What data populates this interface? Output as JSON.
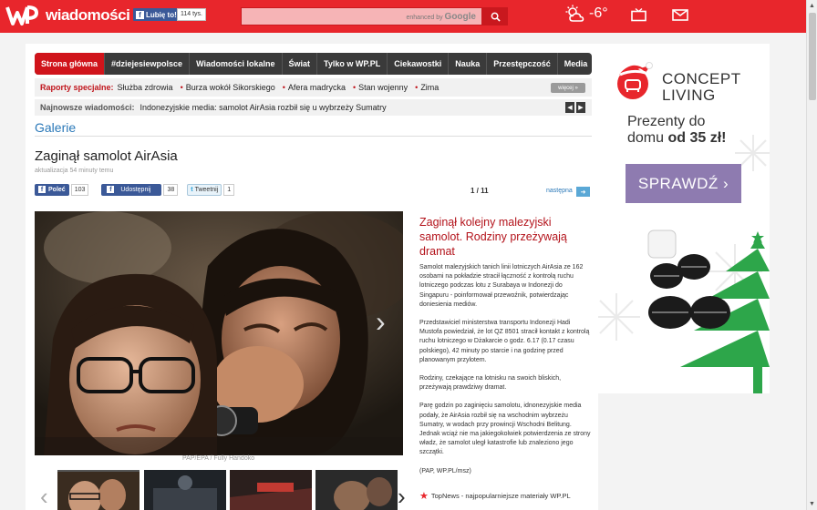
{
  "header": {
    "logo_text": "wiadomości",
    "fb_like_label": "Lubię to!",
    "fb_like_count": "114 tys.",
    "search": {
      "placeholder": "",
      "enhanced_by": "enhanced by",
      "google": "Google"
    },
    "weather": {
      "temperature": "-6°"
    }
  },
  "nav": {
    "items": [
      {
        "label": "Strona główna",
        "active": true
      },
      {
        "label": "#dziejesiewpolsce"
      },
      {
        "label": "Wiadomości lokalne"
      },
      {
        "label": "Świat"
      },
      {
        "label": "Tylko w WP.PL"
      },
      {
        "label": "Ciekawostki"
      },
      {
        "label": "Nauka"
      },
      {
        "label": "Przestępczość"
      },
      {
        "label": "Media"
      }
    ]
  },
  "raporty": {
    "label": "Raporty specjalne:",
    "links": [
      "Służba zdrowia",
      "Burza wokół Sikorskiego",
      "Afera madrycka",
      "Stan wojenny",
      "Zima"
    ],
    "more": "więcej »"
  },
  "newest": {
    "label": "Najnowsze wiadomości:",
    "text": "Indonezyjskie media: samolot AirAsia rozbił się u wybrzeży Sumatry"
  },
  "section": "Galerie",
  "article": {
    "title": "Zaginął samolot AirAsia",
    "updated": "aktualizacja 54 minuty temu",
    "share": {
      "fb_label": "Poleć",
      "fb_count": "103",
      "fb_share_label": "Udostępnij",
      "fb_share_count": "38",
      "tweet_label": "Tweetnij",
      "tweet_count": "1"
    },
    "pager": "1 / 11",
    "next_label": "następna",
    "photo_credit": "PAP/EPA / Fully Handoko",
    "headline": "Zaginął kolejny malezyjski samolot. Rodziny przeżywają dramat",
    "paragraphs": [
      "Samolot malezyjskich tanich linii lotniczych AirAsia ze 162 osobami na pokładzie stracił łączność z kontrolą ruchu lotniczego podczas lotu z Surabaya w Indonezji do Singapuru - poinformował przewoźnik, potwierdzając doniesienia mediów.",
      "Przedstawiciel ministerstwa transportu Indonezji Hadi Mustofa powiedział, że lot QZ 8501 stracił kontakt z kontrolą ruchu lotniczego w Dżakarcie o godz. 6.17 (0.17 czasu polskiego), 42 minuty po starcie i na godzinę przed planowanym przylotem.",
      "Rodziny, czekające na lotnisku na swoich bliskich, przeżywają prawdziwy dramat.",
      "Parę godzin po zaginięciu samolotu, idnonezyjskie media podały, że AirAsia rozbił się na wschodnim wybrzeżu Sumatry, w wodach przy prowincji Wschodni Belitung. Jednak wciąż nie ma jakiegokolwiek potwierdzenia ze strony władz, że samolot uległ katastrofie lub znaleziono jego szczątki.",
      "(PAP, WP.PL/msz)"
    ],
    "topnews": "TopNews - najpopularniejsze materiały WP.PL"
  },
  "ad": {
    "brand_line1": "CONCEPT",
    "brand_line2": "LIVING",
    "line1": "Prezenty do",
    "line2_prefix": "domu",
    "line2_bold": "od 35 zł!",
    "button": "SPRAWDŹ  ›"
  },
  "colors": {
    "brand_red": "#e8262c",
    "nav_dark": "#3a3a3a",
    "link_blue": "#2a78b8",
    "headline_red": "#b3121a",
    "ad_purple": "#8e7bb0",
    "ad_green": "#2da64a"
  }
}
